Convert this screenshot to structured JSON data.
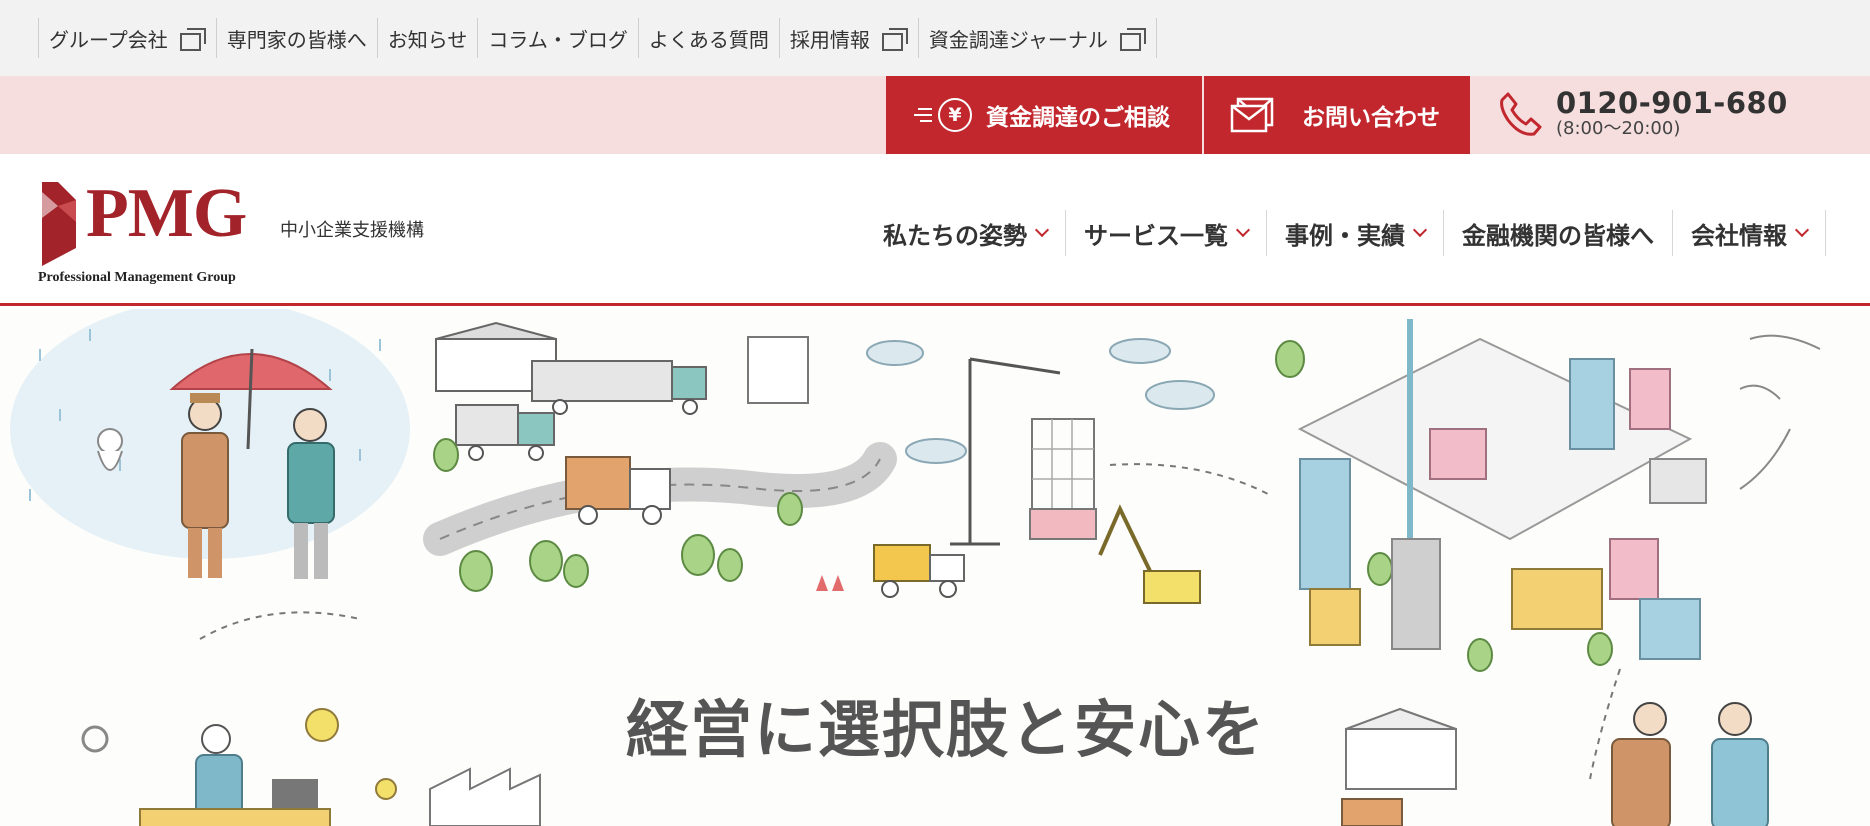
{
  "utility_nav": {
    "items": [
      {
        "label": "グループ会社",
        "external": true
      },
      {
        "label": "専門家の皆様へ",
        "external": false
      },
      {
        "label": "お知らせ",
        "external": false
      },
      {
        "label": "コラム・ブログ",
        "external": false
      },
      {
        "label": "よくある質問",
        "external": false
      },
      {
        "label": "採用情報",
        "external": true
      },
      {
        "label": "資金調達ジャーナル",
        "external": true
      }
    ]
  },
  "contact_bar": {
    "funding_button": "資金調達のご相談",
    "funding_icon": "yen-icon",
    "inquiry_button": "お問い合わせ",
    "inquiry_icon": "mail-icon",
    "phone_icon": "phone-icon",
    "phone_number": "0120-901-680",
    "phone_hours": "(8:00〜20:00)"
  },
  "header": {
    "logo_word": "PMG",
    "logo_subtitle": "Professional Management Group",
    "tagline": "中小企業支援機構",
    "nav": [
      {
        "label": "私たちの姿勢",
        "dropdown": true
      },
      {
        "label": "サービス一覧",
        "dropdown": true
      },
      {
        "label": "事例・実績",
        "dropdown": true
      },
      {
        "label": "金融機関の皆様へ",
        "dropdown": false
      },
      {
        "label": "会社情報",
        "dropdown": true
      }
    ]
  },
  "hero": {
    "catchphrase": "経営に選択肢と安心を"
  },
  "colors": {
    "brand_red": "#c1272d",
    "logo_red": "#a3232a",
    "contact_bar_bg": "#f6dedf",
    "utility_bg": "#f2f2f2"
  }
}
